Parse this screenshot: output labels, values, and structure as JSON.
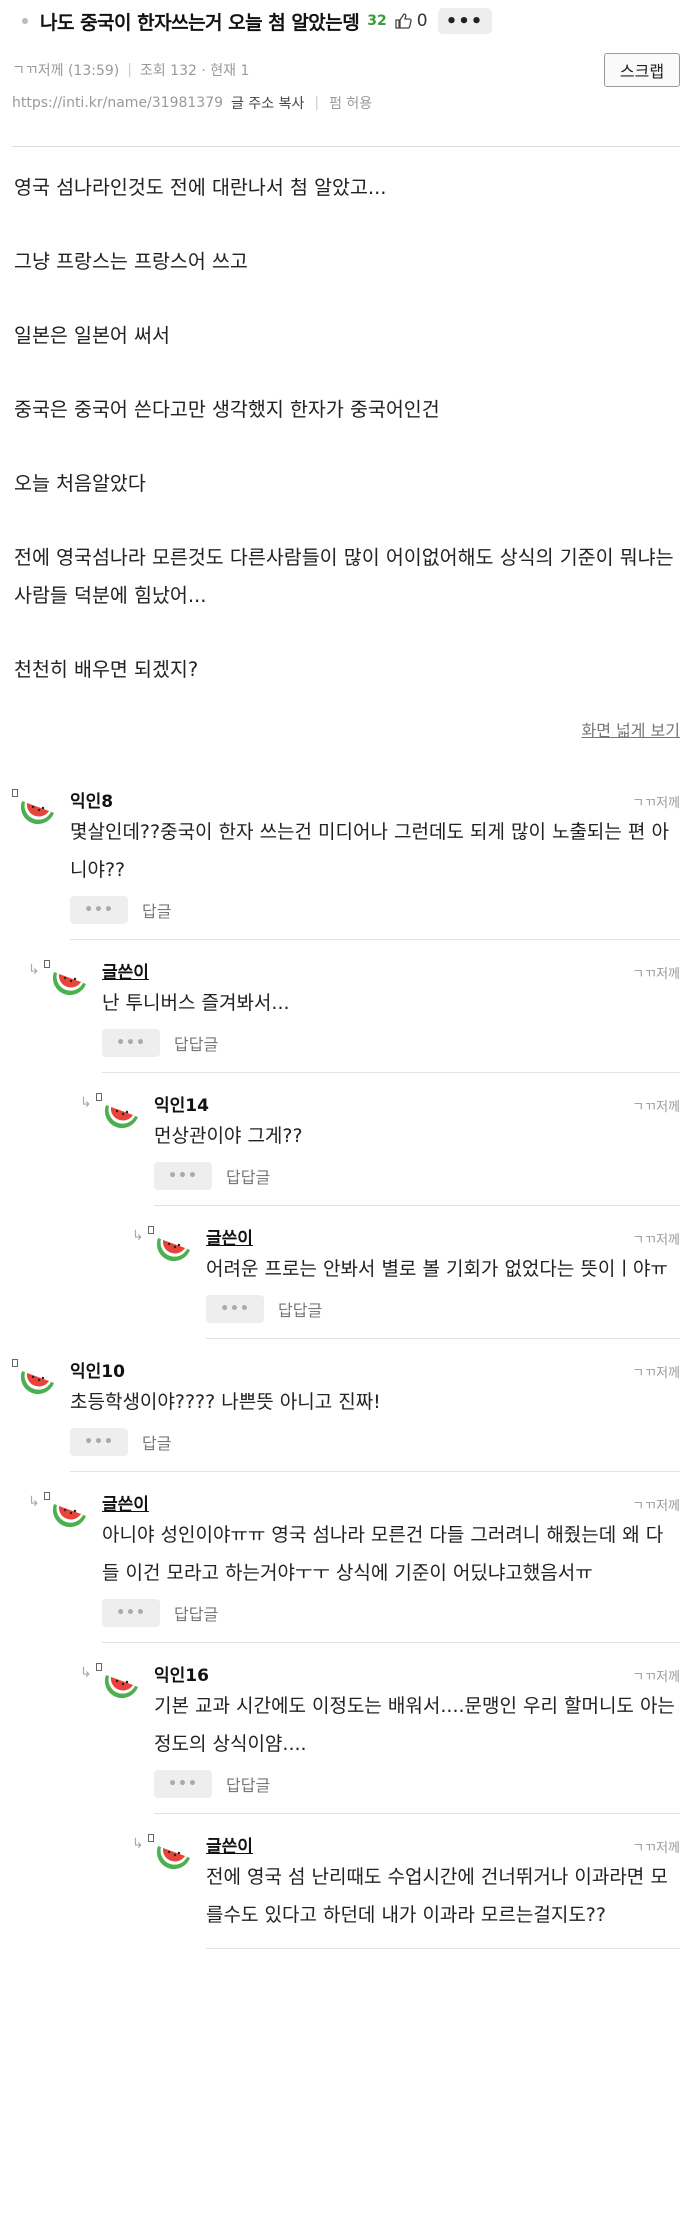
{
  "header": {
    "title": "나도 중국이 한자쓰는거 오늘 첨 알았는뎅",
    "likes": "32",
    "thumb_count": "0",
    "more_label": "•••"
  },
  "meta": {
    "author_time": "ㄱㄲ저께 (13:59)",
    "views": "조회 132 · 현재 1",
    "scrap_label": "스크랩",
    "url": "https://inti.kr/name/31981379",
    "copy_label": "글 주소 복사",
    "permission": "펌 허용"
  },
  "post": {
    "lines": [
      "영국 섬나라인것도 전에 대란나서 첨 알았고...",
      "그냥 프랑스는 프랑스어 쓰고",
      "일본은 일본어 써서",
      "중국은 중국어 쓴다고만 생각했지 한자가 중국어인건",
      "오늘 처음알았다",
      "전에 영국섬나라 모른것도 다른사람들이 많이 어이없어해도 상식의 기준이 뭐냐는 사람들 덕분에 힘났어...",
      "천천히 배우면 되겠지?"
    ],
    "wide_view": "화면 넓게 보기"
  },
  "comments": [
    {
      "depth": 0,
      "name": "익인8",
      "author": false,
      "time": "ㄱㄲ저께",
      "text": "몇살인데??중국이 한자 쓰는건 미디어나 그런데도 되게 많이 노출되는 편 아니야??",
      "reply": "답글"
    },
    {
      "depth": 1,
      "name": "글쓴이",
      "author": true,
      "time": "ㄱㄲ저께",
      "text": "난 투니버스 즐겨봐서...",
      "reply": "답답글"
    },
    {
      "depth": 2,
      "name": "익인14",
      "author": false,
      "time": "ㄱㄲ저께",
      "text": "먼상관이야 그게??",
      "reply": "답답글"
    },
    {
      "depth": 3,
      "name": "글쓴이",
      "author": true,
      "time": "ㄱㄲ저께",
      "text": "어려운 프로는 안봐서 별로 볼 기회가 없었다는 뜻이ㅣ야ㅠ",
      "reply": "답답글"
    },
    {
      "depth": 0,
      "name": "익인10",
      "author": false,
      "time": "ㄱㄲ저께",
      "text": "초등학생이야???? 나쁜뜻 아니고 진짜!",
      "reply": "답글"
    },
    {
      "depth": 1,
      "name": "글쓴이",
      "author": true,
      "time": "ㄱㄲ저께",
      "text": "아니야 성인이야ㅠㅠ 영국 섬나라 모른건 다들 그러려니 해줬는데 왜 다들 이건 모라고 하는거야ㅜㅜ 상식에 기준이 어딨냐고했음서ㅠ",
      "reply": "답답글"
    },
    {
      "depth": 2,
      "name": "익인16",
      "author": false,
      "time": "ㄱㄲ저께",
      "text": "기본 교과 시간에도 이정도는 배워서....문맹인 우리 할머니도 아는 정도의 상식이얌....",
      "reply": "답답글"
    },
    {
      "depth": 3,
      "name": "글쓴이",
      "author": true,
      "time": "ㄱㄲ저께",
      "text": "전에 영국 섬 난리때도 수업시간에 건너뛰거나 이과라면 모를수도 있다고 하던데 내가 이과라 모르는걸지도??",
      "reply": ""
    }
  ],
  "icons": {
    "thumb": "thumbs-up-icon",
    "avatar": "watermelon-icon",
    "reply_arrow": "reply-arrow-icon"
  },
  "colors": {
    "like_green": "#3a9b3a",
    "watermelon_red": "#e8443a",
    "watermelon_green": "#4caf50"
  }
}
